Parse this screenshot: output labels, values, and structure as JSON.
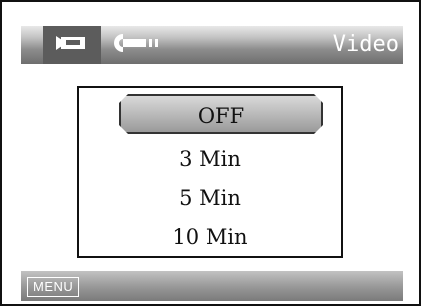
{
  "header": {
    "title": "Video",
    "tabs": [
      {
        "icon": "camera-icon",
        "selected": true
      },
      {
        "icon": "wrench-icon",
        "selected": false
      }
    ]
  },
  "options": {
    "items": [
      {
        "label": "OFF",
        "selected": true
      },
      {
        "label": "3 Min",
        "selected": false
      },
      {
        "label": "5 Min",
        "selected": false
      },
      {
        "label": "10 Min",
        "selected": false
      }
    ]
  },
  "footer": {
    "menu_label": "MENU"
  },
  "colors": {
    "header_bg": "#8c8c8c",
    "selected_tab_bg": "#5c5c5c",
    "text_light": "#ffffff",
    "text_dark": "#111111"
  }
}
